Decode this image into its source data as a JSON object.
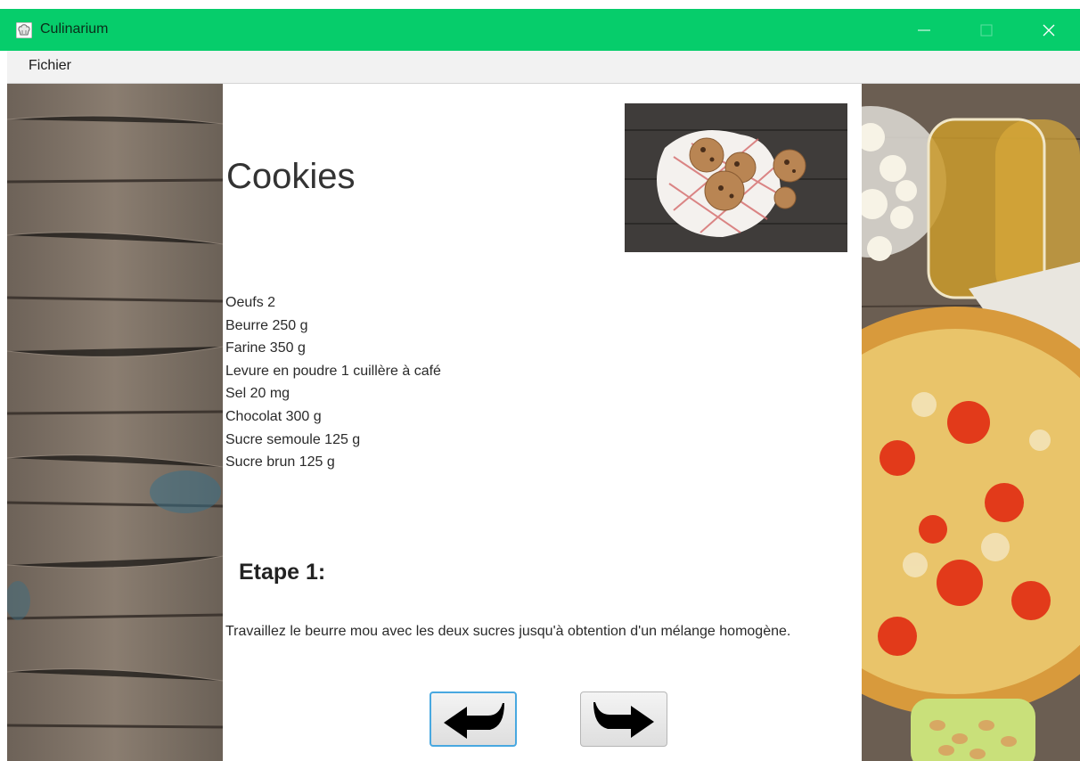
{
  "window": {
    "title": "Culinarium",
    "icon": "chef-hat-icon",
    "controls": [
      "minimize-icon",
      "maximize-icon",
      "close-icon"
    ],
    "accent_color": "#06cd6b"
  },
  "menu": {
    "items": [
      {
        "label": "Fichier"
      }
    ]
  },
  "recipe": {
    "title": "Cookies",
    "photo": "cookies-photo",
    "ingredients": [
      "Oeufs 2",
      "Beurre 250 g",
      "Farine 350 g",
      "Levure en poudre 1 cuillère à café",
      "Sel 20 mg",
      "Chocolat 300 g",
      "Sucre semoule 125 g",
      "Sucre brun 125 g"
    ],
    "step": {
      "title": "Etape 1:",
      "text": "Travaillez le beurre mou avec les deux sucres jusqu'à obtention d'un mélange homogène."
    }
  },
  "navigation": {
    "previous_icon": "back-arrow-icon",
    "next_icon": "forward-arrow-icon"
  }
}
